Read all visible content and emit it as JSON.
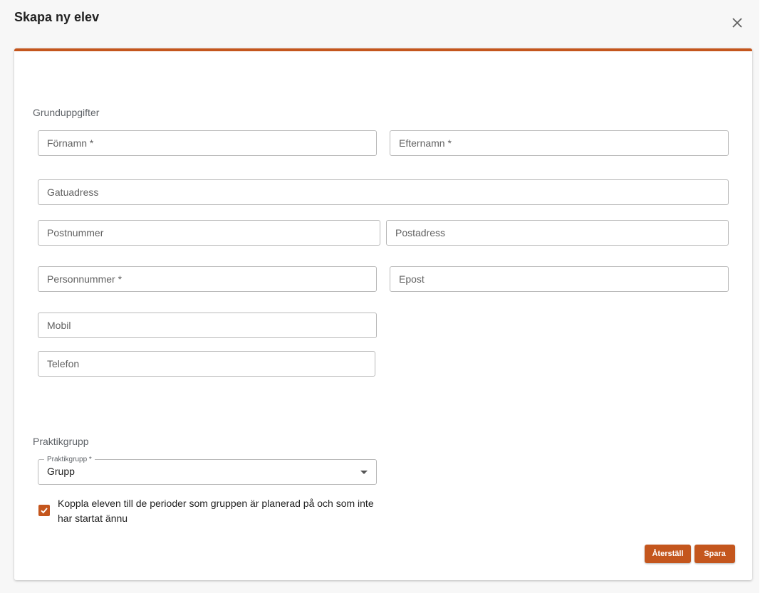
{
  "dialog": {
    "title": "Skapa ny elev",
    "close_icon": "close-icon"
  },
  "basic_info": {
    "section_title": "Grunduppgifter",
    "fields": {
      "first_name": {
        "placeholder": "Förnamn *",
        "value": ""
      },
      "last_name": {
        "placeholder": "Efternamn *",
        "value": ""
      },
      "street": {
        "placeholder": "Gatuadress",
        "value": ""
      },
      "postal_code": {
        "placeholder": "Postnummer",
        "value": ""
      },
      "postal_address": {
        "placeholder": "Postadress",
        "value": ""
      },
      "personal_id": {
        "placeholder": "Personnummer *",
        "value": ""
      },
      "email": {
        "placeholder": "Epost",
        "value": ""
      },
      "mobile": {
        "placeholder": "Mobil",
        "value": ""
      },
      "phone": {
        "placeholder": "Telefon",
        "value": ""
      }
    }
  },
  "practice_group": {
    "section_title": "Praktikgrupp",
    "select_label": "Praktikgrupp *",
    "select_value": "Grupp",
    "checkbox_checked": true,
    "checkbox_label": "Koppla eleven till de perioder som gruppen är planerad på och som inte har startat ännu"
  },
  "actions": {
    "reset_label": "Återställ",
    "save_label": "Spara"
  },
  "colors": {
    "accent": "#c4561d"
  }
}
